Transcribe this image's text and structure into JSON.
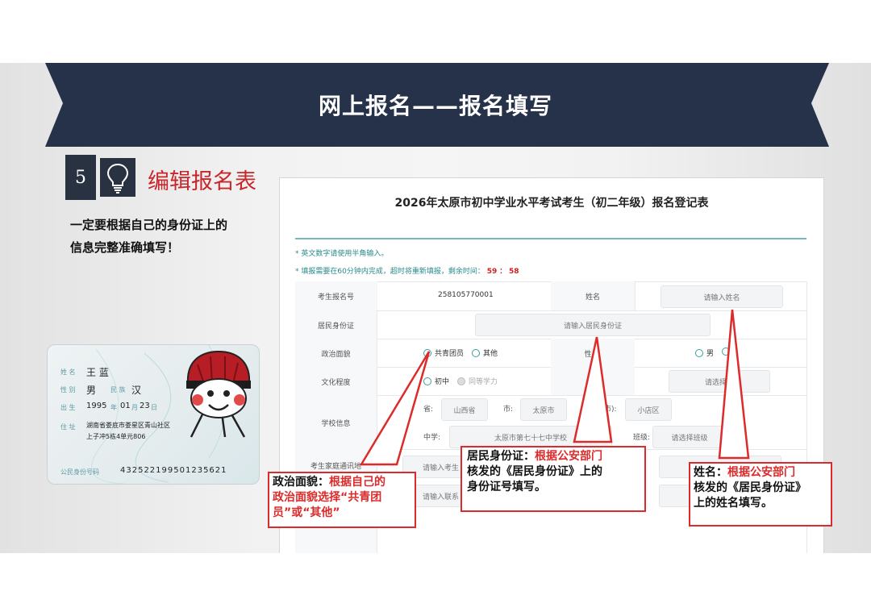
{
  "banner": {
    "title": "网上报名——报名填写"
  },
  "step": {
    "number": "5",
    "title": "编辑报名表",
    "icon": "lightbulb-icon"
  },
  "note": {
    "line1": "一定要根据自己的身份证上的",
    "line2": "信息完整准确填写！"
  },
  "idcard": {
    "name_label": "姓 名",
    "name": "王 蓝",
    "sex_label": "性 别",
    "sex": "男",
    "ethnic_label": "民 族",
    "ethnic": "汉",
    "birth_label": "出 生",
    "birth_year": "1995",
    "year_unit": "年",
    "birth_month": "01",
    "month_unit": "月",
    "birth_day": "23",
    "day_unit": "日",
    "addr_label": "住 址",
    "addr1": "湖南省娄底市娄星区青山社区",
    "addr2": "上子冲5栋4单元806",
    "id_label": "公民身份号码",
    "id_number": "432522199501235621"
  },
  "form": {
    "title": "2026年太原市初中学业水平考试考生（初二年级）报名登记表",
    "tip1": "* 英文数字请使用半角输入。",
    "tip2_prefix": "* 填报需要在60分钟内完成，超时将重新填报，剩余时间：",
    "timer_min": "59",
    "timer_sep": "：",
    "timer_sec": "58",
    "rows": {
      "reg_no_label": "考生报名号",
      "reg_no": "258105770001",
      "name_label": "姓名",
      "name_placeholder": "请输入姓名",
      "id_label": "居民身份证",
      "id_placeholder": "请输入居民身份证",
      "politics_label": "政治面貌",
      "politics_opt1": "共青团员",
      "politics_opt2": "其他",
      "gender_label_partial": "性",
      "gender_opt1": "男",
      "education_label": "文化程度",
      "edu_opt1": "初中",
      "edu_opt2": "同等学力",
      "edu_select": "请选择民",
      "school_label": "学校信息",
      "province_label": "省:",
      "province": "山西省",
      "city_label": "市:",
      "city": "太原市",
      "district_label": "市):",
      "district": "小店区",
      "middle_label": "中学:",
      "middle": "太原市第七十七中学校",
      "class_label": "班级:",
      "class_placeholder": "请选择班级",
      "address_label": "考生家庭通讯地",
      "address_placeholder": "请输入考生",
      "contact_placeholder": "请输入联系"
    }
  },
  "callouts": {
    "politics": {
      "key": "政治面貌",
      "colon": "：",
      "text1": "根据自己的",
      "text2": "政治面貌选择“共青团",
      "text3": "员”或“其他”"
    },
    "id": {
      "key": "居民身份证",
      "colon": "：",
      "text1": "根据公安部门",
      "text2": "核发的《居民身份证》上的",
      "text3": "身份证号填写。"
    },
    "name": {
      "key": "姓名",
      "colon": "：",
      "text1": "根据公安部门",
      "text2": "核发的《居民身份证》",
      "text3": "上的姓名填写。"
    }
  },
  "colors": {
    "banner": "#26324a",
    "accent": "#c9262c",
    "teal": "#4aabab",
    "callout_border": "#dd2a2a"
  }
}
